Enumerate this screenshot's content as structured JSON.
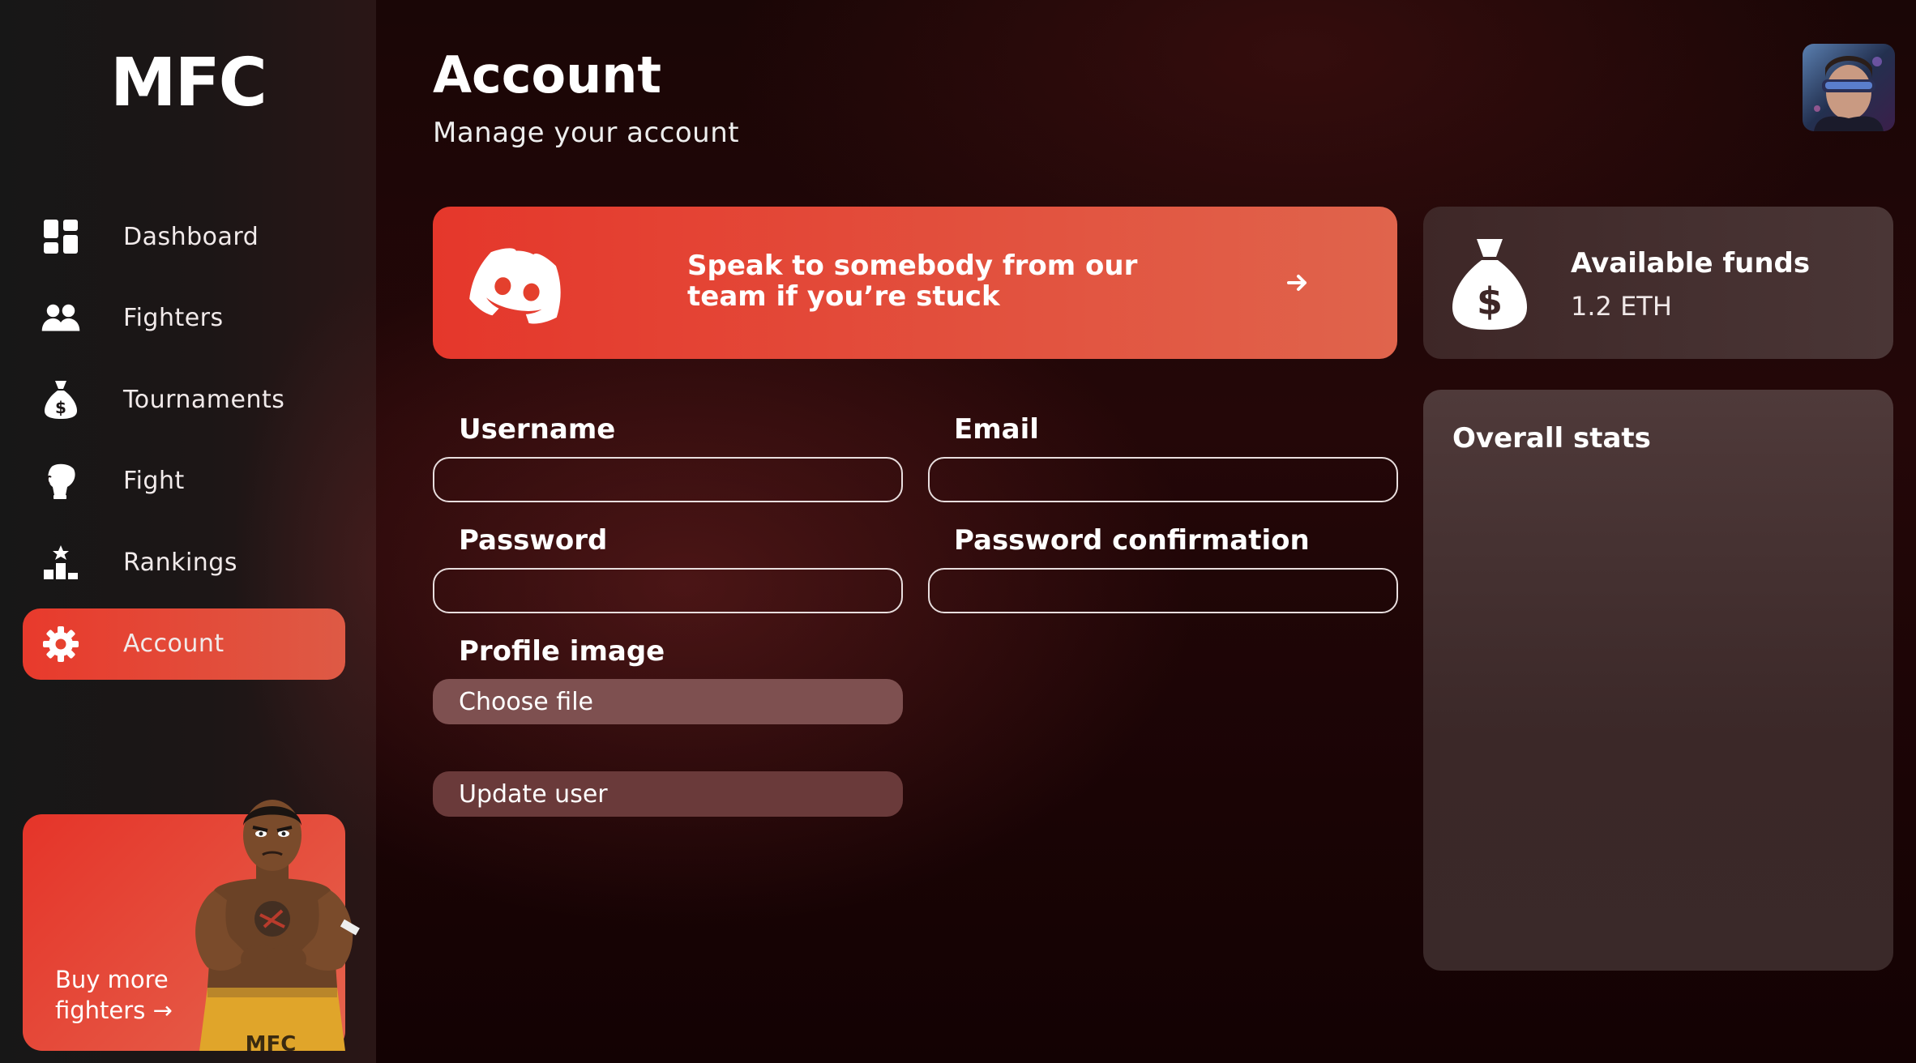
{
  "brand": {
    "logo_text": "MFC"
  },
  "sidebar": {
    "items": [
      {
        "label": "Dashboard",
        "icon": "dashboard-icon"
      },
      {
        "label": "Fighters",
        "icon": "users-icon"
      },
      {
        "label": "Tournaments",
        "icon": "money-bag-icon"
      },
      {
        "label": "Fight",
        "icon": "boxing-glove-icon"
      },
      {
        "label": "Rankings",
        "icon": "podium-icon"
      },
      {
        "label": "Account",
        "icon": "gear-icon",
        "active": true
      }
    ],
    "promo": {
      "line1": "Buy more",
      "line2": "fighters →"
    }
  },
  "header": {
    "title": "Account",
    "subtitle": "Manage your account"
  },
  "discord": {
    "line1": "Speak to somebody from our",
    "line2": "team if you’re stuck"
  },
  "form": {
    "username_label": "Username",
    "username_value": "",
    "email_label": "Email",
    "email_value": "",
    "password_label": "Password",
    "password_value": "",
    "password_confirmation_label": "Password confirmation",
    "password_confirmation_value": "",
    "profile_image_label": "Profile image",
    "choose_file_label": "Choose file",
    "update_button_label": "Update user"
  },
  "funds": {
    "title": "Available funds",
    "value": "1.2 ETH"
  },
  "stats": {
    "title": "Overall stats"
  },
  "colors": {
    "accent_start": "#e5372b",
    "accent_end": "#e0644c",
    "background": "#1a0606",
    "card": "#4a3636"
  }
}
